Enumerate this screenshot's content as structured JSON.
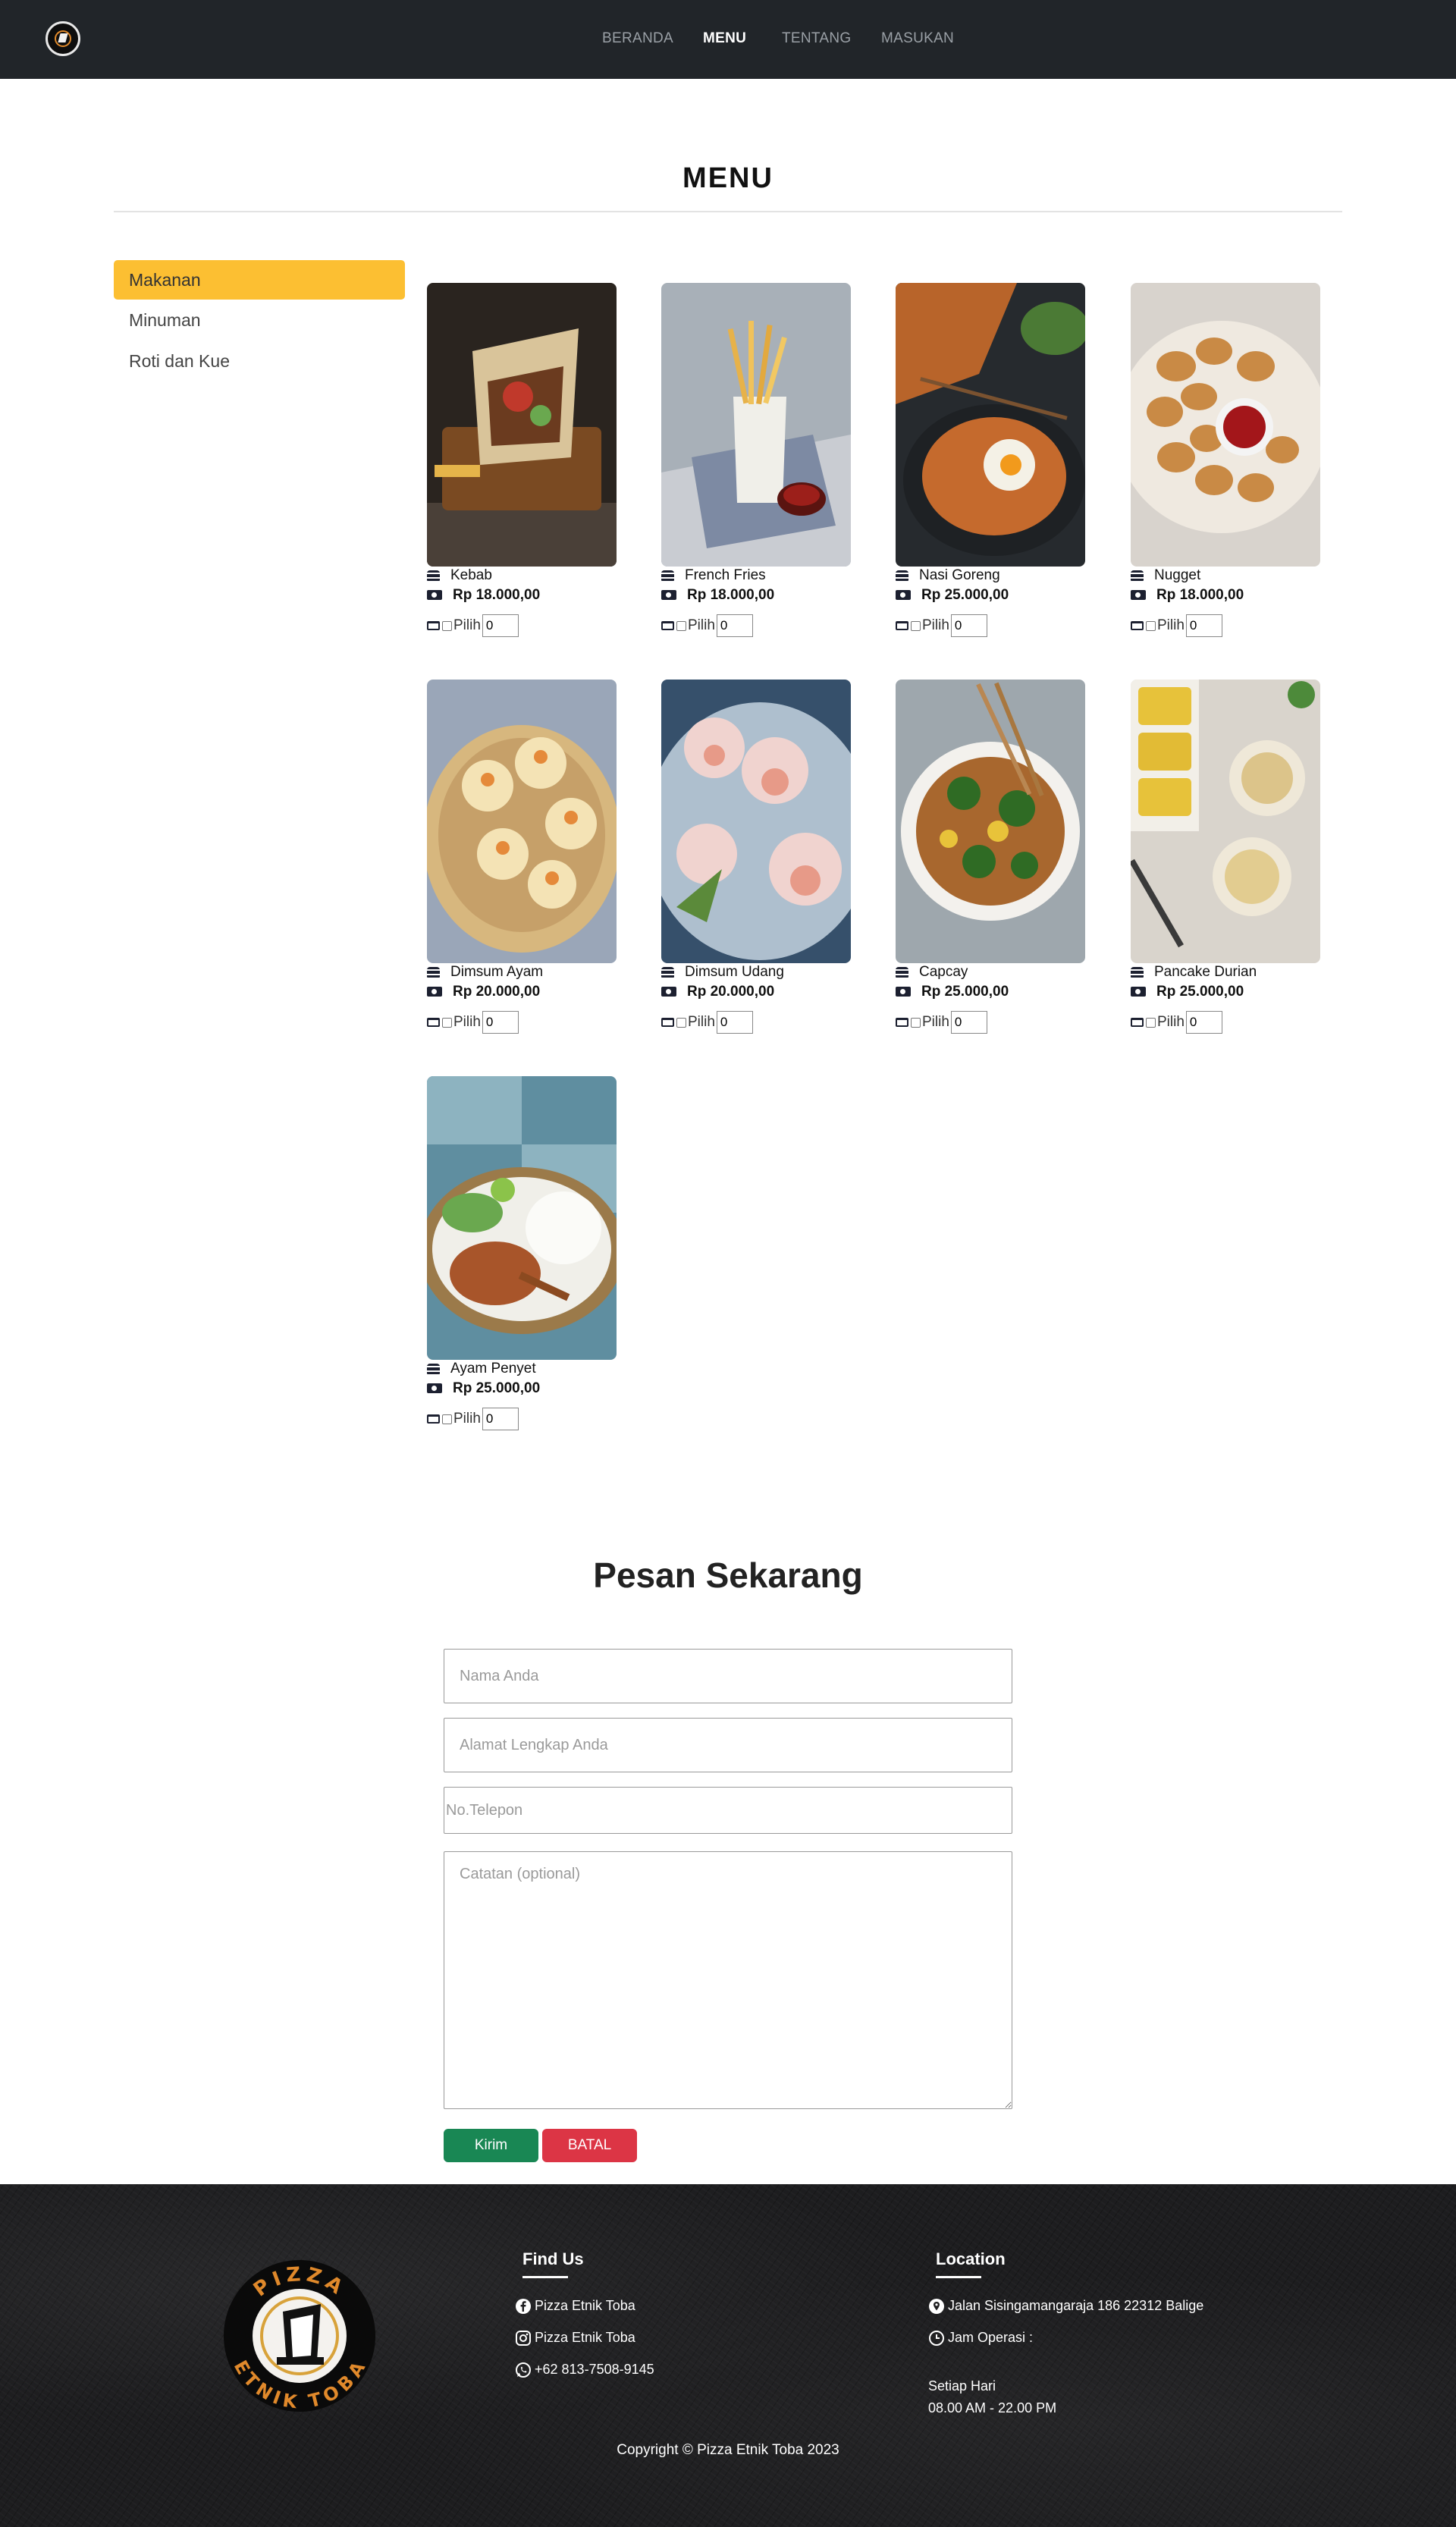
{
  "nav": {
    "links": [
      {
        "label": "BERANDA",
        "active": false
      },
      {
        "label": "MENU",
        "active": true
      },
      {
        "label": "TENTANG",
        "active": false
      },
      {
        "label": "MASUKAN",
        "active": false
      }
    ]
  },
  "menu": {
    "title": "MENU",
    "categories": [
      {
        "label": "Makanan",
        "active": true
      },
      {
        "label": "Minuman",
        "active": false
      },
      {
        "label": "Roti dan Kue",
        "active": false
      }
    ],
    "pick_label": "Pilih",
    "items": [
      {
        "name": "Kebab",
        "price": "Rp 18.000,00",
        "qty": "0"
      },
      {
        "name": "French Fries",
        "price": "Rp 18.000,00",
        "qty": "0"
      },
      {
        "name": "Nasi Goreng",
        "price": "Rp 25.000,00",
        "qty": "0"
      },
      {
        "name": "Nugget",
        "price": "Rp 18.000,00",
        "qty": "0"
      },
      {
        "name": "Dimsum Ayam",
        "price": "Rp 20.000,00",
        "qty": "0"
      },
      {
        "name": "Dimsum Udang",
        "price": "Rp 20.000,00",
        "qty": "0"
      },
      {
        "name": "Capcay",
        "price": "Rp 25.000,00",
        "qty": "0"
      },
      {
        "name": "Pancake Durian",
        "price": "Rp 25.000,00",
        "qty": "0"
      },
      {
        "name": "Ayam Penyet",
        "price": "Rp 25.000,00",
        "qty": "0"
      }
    ]
  },
  "order": {
    "title": "Pesan Sekarang",
    "name_placeholder": "Nama Anda",
    "address_placeholder": "Alamat Lengkap Anda",
    "phone_placeholder": "No.Telepon",
    "notes_placeholder": "Catatan (optional)",
    "submit_label": "Kirim",
    "cancel_label": "BATAL"
  },
  "footer": {
    "logo_text_top": "PIZZA",
    "logo_text_bottom": "ETNIK TOBA",
    "find_us_heading": "Find Us",
    "facebook": "Pizza Etnik Toba",
    "instagram": "Pizza Etnik Toba",
    "whatsapp": "+62 813-7508-9145",
    "location_heading": "Location",
    "address": "Jalan Sisingamangaraja 186 22312 Balige",
    "hours_label": "Jam Operasi :",
    "hours_days": "Setiap Hari",
    "hours_time": "08.00 AM - 22.00 PM",
    "copyright": "Copyright © Pizza Etnik Toba 2023"
  },
  "colors": {
    "navbar": "#212529",
    "category_active": "#fcbf32",
    "submit_button": "#198754",
    "cancel_button": "#dc3545",
    "logo_accent": "#e0892b"
  }
}
